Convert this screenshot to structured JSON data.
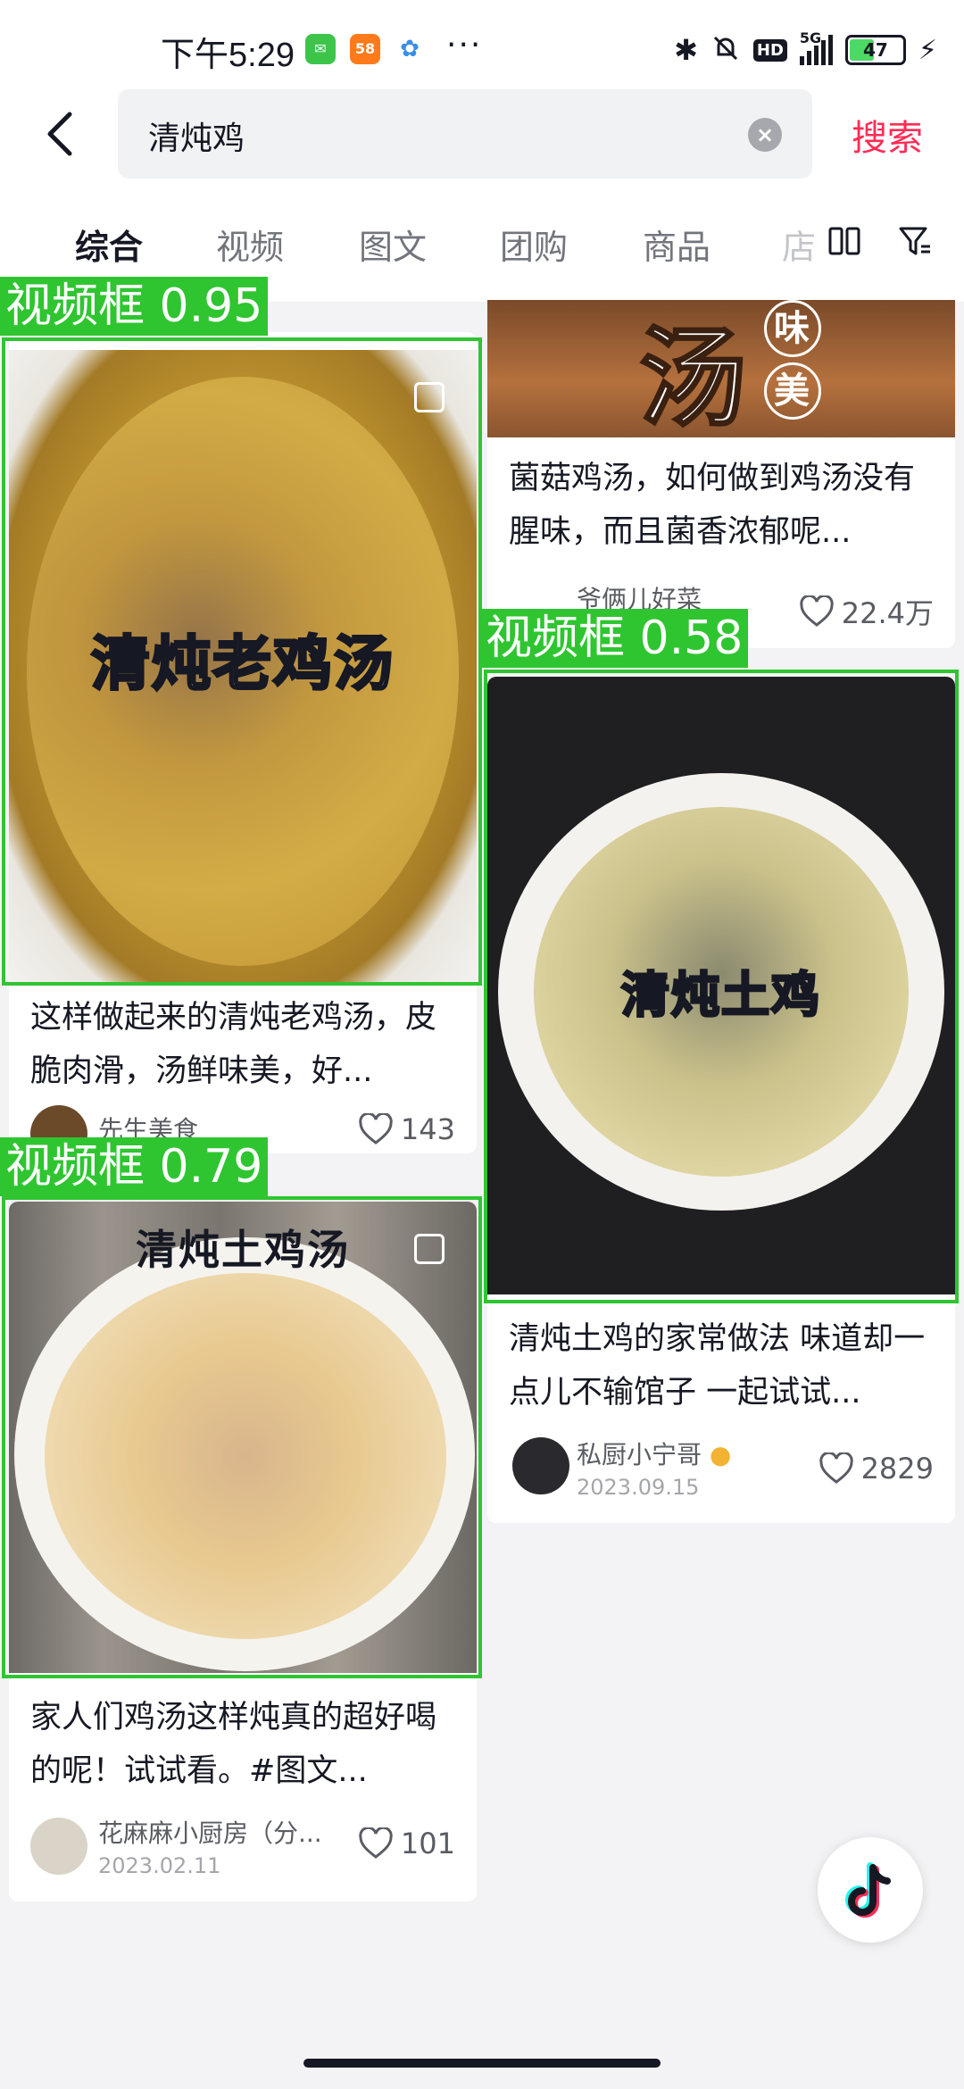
{
  "status_bar": {
    "time": "下午5:29",
    "badge_58": "58",
    "dots": "···",
    "hd": "HD",
    "network": "5G",
    "battery": "47"
  },
  "search": {
    "query": "清炖鸡",
    "submit_label": "搜索"
  },
  "tabs": [
    {
      "label": "综合"
    },
    {
      "label": "视频"
    },
    {
      "label": "图文"
    },
    {
      "label": "团购"
    },
    {
      "label": "商品"
    },
    {
      "label": "店"
    }
  ],
  "cards": [
    {
      "overlay": "清炖老鸡汤",
      "title": "这样做起来的清炖老鸡汤，皮脆肉滑，汤鲜味美，好...",
      "author": "先生美食",
      "likes": "143"
    },
    {
      "overlay": "清炖土鸡汤",
      "title": "家人们鸡汤这样炖真的超好喝的呢！试试看。#图文...",
      "author": "花麻麻小厨房（分...",
      "date": "2023.02.11",
      "likes": "101"
    },
    {
      "overlay_big": "汤",
      "overlay_small_1": "味",
      "overlay_small_2": "美",
      "title": "菌菇鸡汤，如何做到鸡汤没有腥味，而且菌香浓郁呢...",
      "author": "爷俩儿好菜",
      "likes": "22.4万"
    },
    {
      "overlay": "清炖土鸡",
      "title": "清炖土鸡的家常做法 味道却一点儿不输馆子 一起试试...",
      "author": "私厨小宁哥",
      "date": "2023.09.15",
      "likes": "2829"
    }
  ],
  "detections": [
    {
      "label": "视频框 0.95"
    },
    {
      "label": "视频框 0.79"
    },
    {
      "label": "视频框 0.58"
    }
  ],
  "colors": {
    "accent": "#fe2c55",
    "detection": "#2fc531"
  },
  "icons": [
    "back-arrow-icon",
    "clear-icon",
    "layout-toggle-icon",
    "filter-icon",
    "heart-icon",
    "douyin-logo-icon"
  ]
}
